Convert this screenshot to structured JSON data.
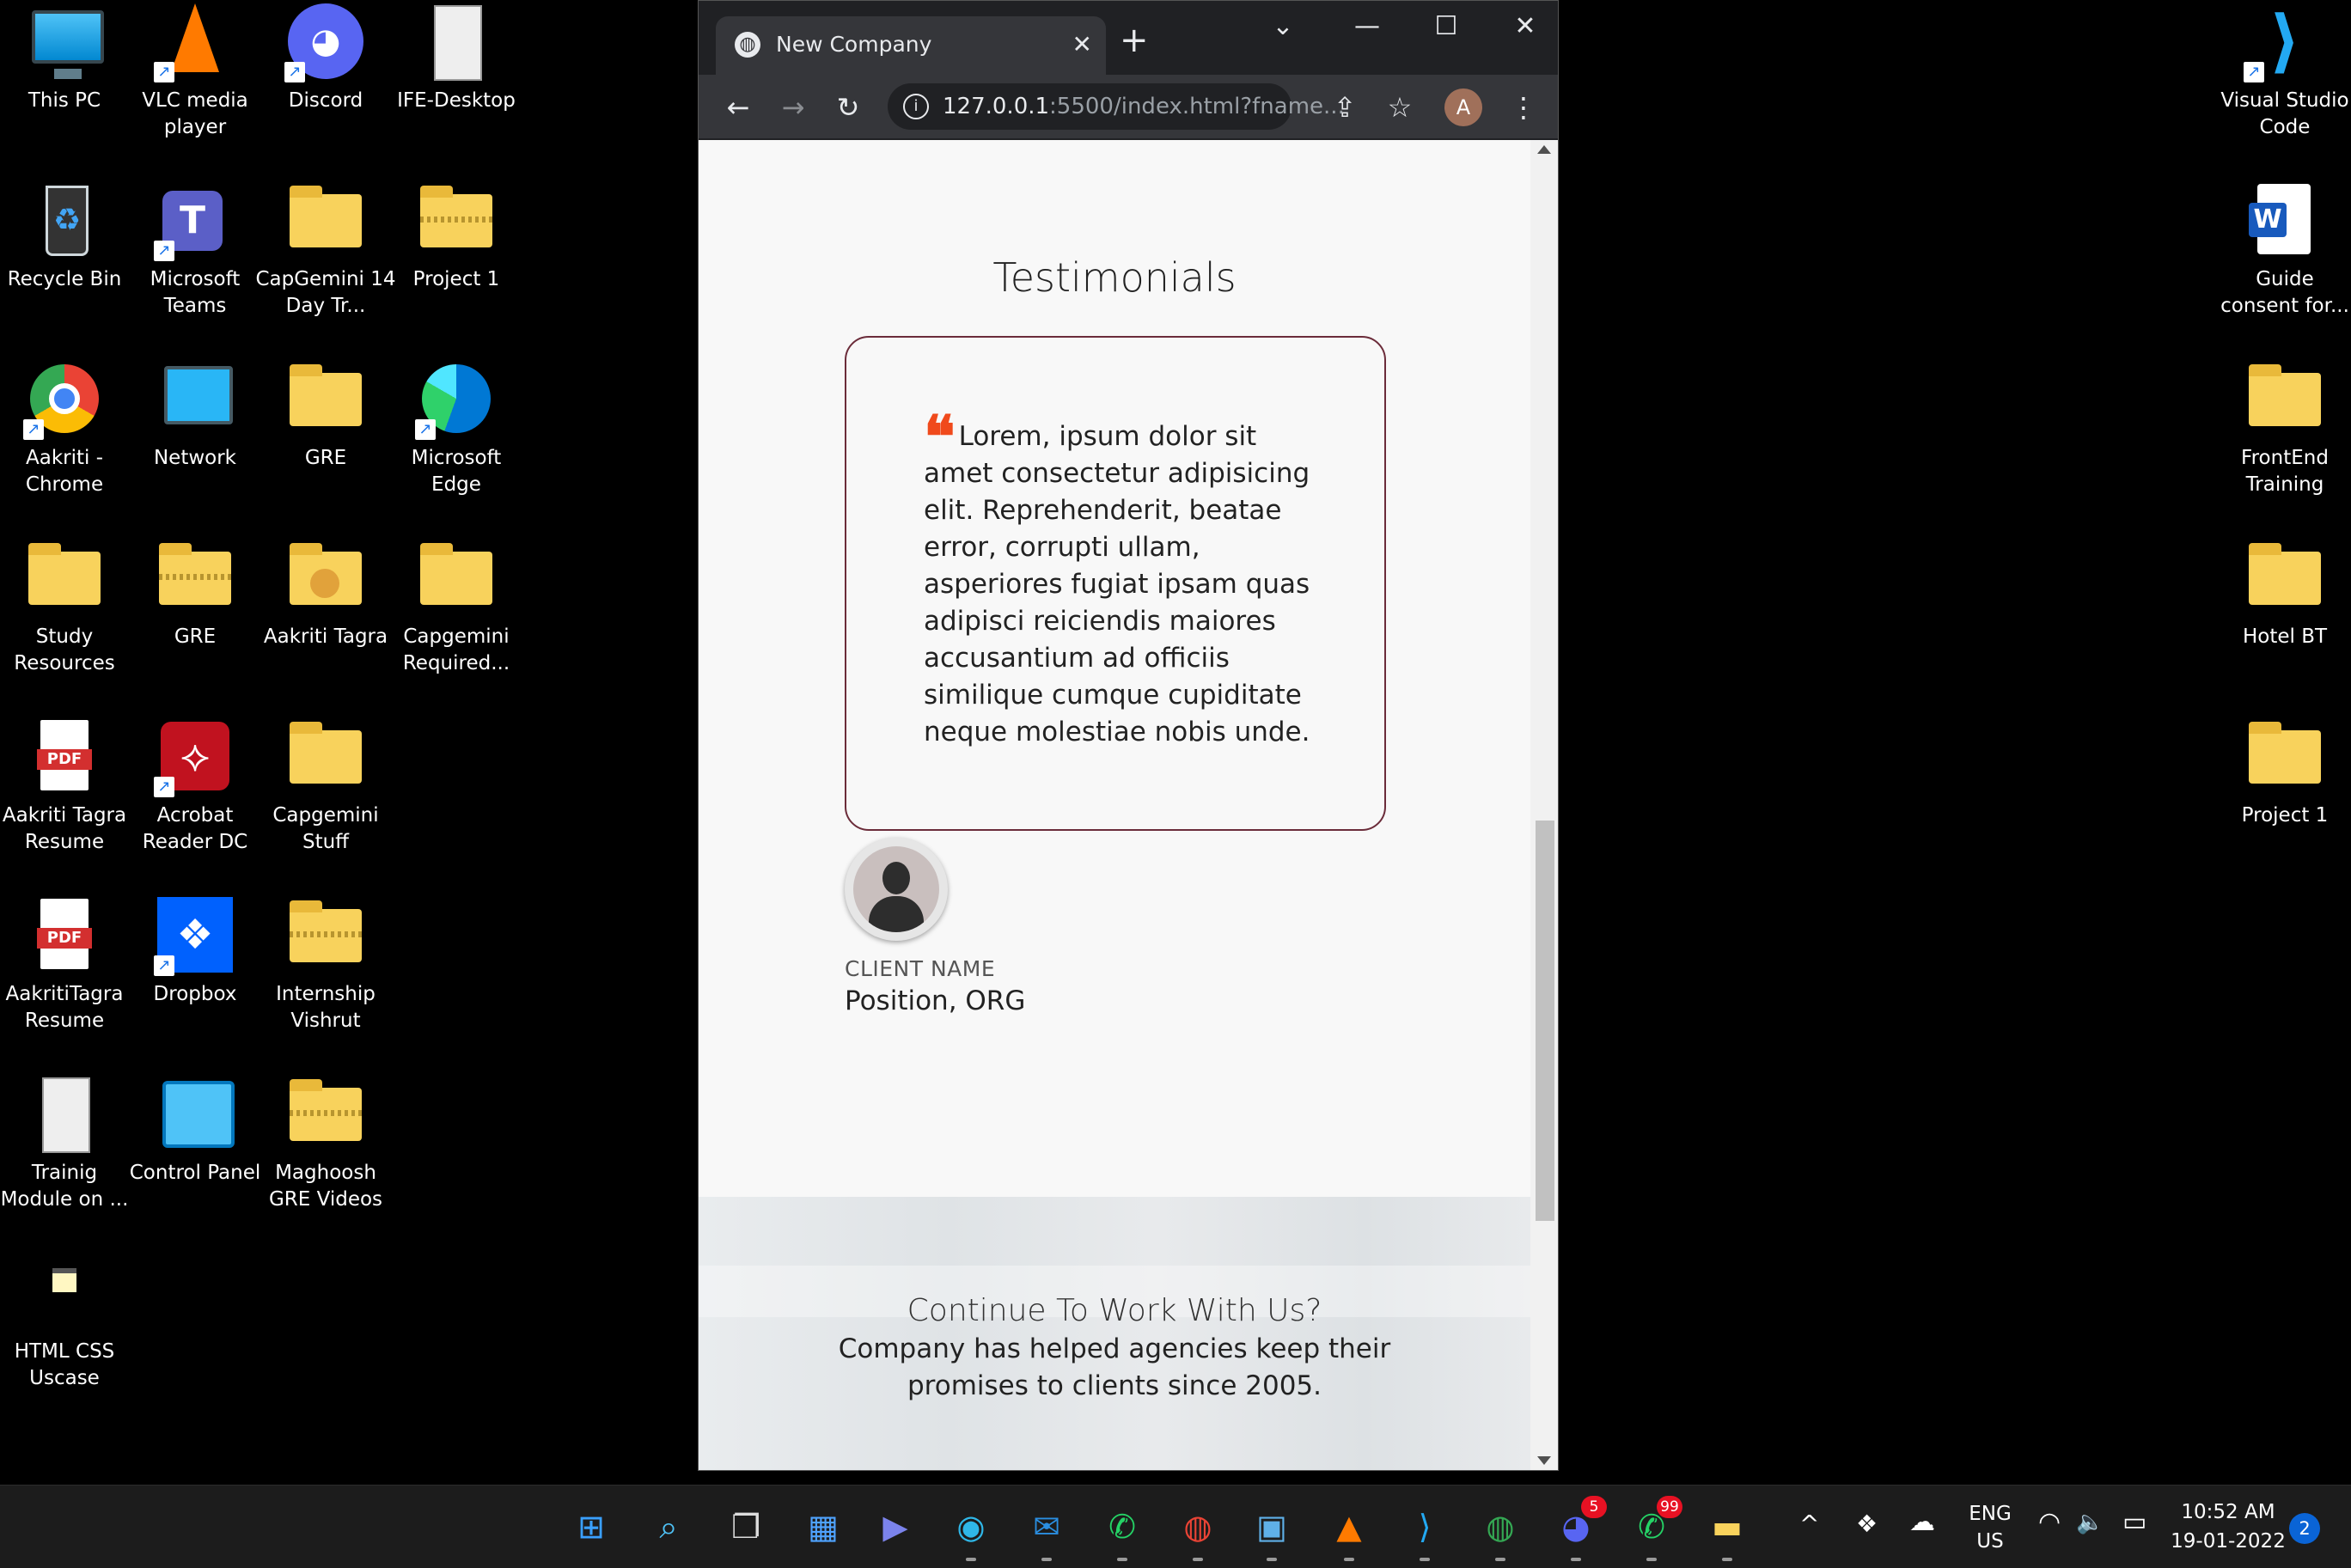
{
  "desktop": {
    "left_icons": [
      {
        "label": "This PC",
        "icon": "monitor-icon"
      },
      {
        "label": "VLC media player",
        "icon": "vlc-cone-icon"
      },
      {
        "label": "Discord",
        "icon": "discord-icon"
      },
      {
        "label": "IFE-Desktop",
        "icon": "document-thumbnail-icon"
      },
      {
        "label": "Recycle Bin",
        "icon": "recycle-bin-icon"
      },
      {
        "label": "Microsoft Teams",
        "icon": "teams-icon"
      },
      {
        "label": "CapGemini 14 Day Tr...",
        "icon": "folder-icon"
      },
      {
        "label": "Project 1",
        "icon": "zip-folder-icon"
      },
      {
        "label": "Aakriti - Chrome",
        "icon": "chrome-icon"
      },
      {
        "label": "Network",
        "icon": "network-icon"
      },
      {
        "label": "GRE",
        "icon": "folder-icon"
      },
      {
        "label": "Microsoft Edge",
        "icon": "edge-icon"
      },
      {
        "label": "Study Resources",
        "icon": "folder-icon"
      },
      {
        "label": "GRE",
        "icon": "zip-folder-icon"
      },
      {
        "label": "Aakriti Tagra",
        "icon": "user-folder-icon"
      },
      {
        "label": "Capgemini Required...",
        "icon": "folder-icon"
      },
      {
        "label": "Aakriti Tagra Resume",
        "icon": "pdf-icon"
      },
      {
        "label": "Acrobat Reader DC",
        "icon": "acrobat-icon"
      },
      {
        "label": "Capgemini Stuff",
        "icon": "folder-icon"
      },
      {
        "label": "AakritiTagra Resume",
        "icon": "pdf-icon"
      },
      {
        "label": "Dropbox",
        "icon": "dropbox-icon"
      },
      {
        "label": "Internship Vishrut",
        "icon": "zip-folder-icon"
      },
      {
        "label": "Trainig Module on ...",
        "icon": "document-thumbnail-icon"
      },
      {
        "label": "Control Panel",
        "icon": "control-panel-icon"
      },
      {
        "label": "Maghoosh GRE Videos",
        "icon": "zip-folder-icon"
      },
      {
        "label": "HTML CSS Uscase",
        "icon": "html-file-icon"
      }
    ],
    "right_icons": [
      {
        "label": "Visual Studio Code",
        "icon": "vscode-icon"
      },
      {
        "label": "Guide consent for...",
        "icon": "word-icon"
      },
      {
        "label": "FrontEnd Training",
        "icon": "folder-icon"
      },
      {
        "label": "Hotel BT",
        "icon": "folder-icon"
      },
      {
        "label": "Project 1",
        "icon": "folder-icon"
      }
    ],
    "pdf_badge": "PDF",
    "word_badge": "W",
    "teams_badge": "T"
  },
  "browser": {
    "tab_title": "New Company",
    "tab_close": "✕",
    "new_tab": "+",
    "window_controls": {
      "dropdown": "⌄",
      "minimize": "—",
      "maximize": "☐",
      "close": "✕"
    },
    "url_host": "127.0.0.1",
    "url_rest": ":5500/index.html?fname...",
    "info_glyph": "i",
    "profile_initial": "A",
    "nav": {
      "back": "←",
      "forward": "→",
      "reload": "↻",
      "share": "⇪",
      "star": "☆",
      "menu": "⋮"
    }
  },
  "page": {
    "testimonials_heading": "Testimonials",
    "quote_mark": "❝",
    "quote": "Lorem, ipsum dolor sit amet consectetur adipisicing elit. Reprehenderit, beatae error, corrupti ullam, asperiores fugiat ipsam quas adipisci reiciendis maiores accusantium ad officiis similique cumque cupiditate neque molestiae nobis unde.",
    "client_name": "CLIENT NAME",
    "client_position": "Position, ORG",
    "cta_title": "Continue To Work With Us?",
    "cta_text": "Company has helped agencies keep their promises to clients since 2005.",
    "accent_color": "#f04a1c",
    "card_border_color": "#6b2c3a"
  },
  "taskbar": {
    "apps": [
      {
        "name": "start",
        "glyph": "⊞",
        "color": "#3aa0ff"
      },
      {
        "name": "search",
        "glyph": "⌕",
        "color": "#4fc3f7"
      },
      {
        "name": "task-view",
        "glyph": "❐",
        "color": "#dddddd"
      },
      {
        "name": "widgets",
        "glyph": "▦",
        "color": "#4fa3ff"
      },
      {
        "name": "chat",
        "glyph": "▶",
        "color": "#7b83eb"
      },
      {
        "name": "edge",
        "glyph": "◉",
        "color": "#2fb7e8"
      },
      {
        "name": "mail",
        "glyph": "✉",
        "color": "#2a8ee0"
      },
      {
        "name": "whatsapp",
        "glyph": "✆",
        "color": "#25d366"
      },
      {
        "name": "chrome",
        "glyph": "◍",
        "color": "#ea4335"
      },
      {
        "name": "photos",
        "glyph": "▣",
        "color": "#5fb0e8"
      },
      {
        "name": "vlc",
        "glyph": "▲",
        "color": "#ff7a00"
      },
      {
        "name": "vscode",
        "glyph": "⟩",
        "color": "#23a9f2"
      },
      {
        "name": "chrome-profiles",
        "glyph": "◍",
        "color": "#34a853"
      },
      {
        "name": "discord",
        "glyph": "◕",
        "color": "#5865f2",
        "badge": "5"
      },
      {
        "name": "whatsapp-2",
        "glyph": "✆",
        "color": "#25d366",
        "badge": "99"
      },
      {
        "name": "file-explorer",
        "glyph": "▬",
        "color": "#f8d25c"
      }
    ],
    "tray": {
      "chevron": "^",
      "dropbox": "❖",
      "onedrive": "☁",
      "language_1": "ENG",
      "language_2": "US",
      "wifi": "◠",
      "volume": "🔈",
      "battery": "▭",
      "time": "10:52 AM",
      "date": "19-01-2022",
      "notifications": "2"
    }
  }
}
